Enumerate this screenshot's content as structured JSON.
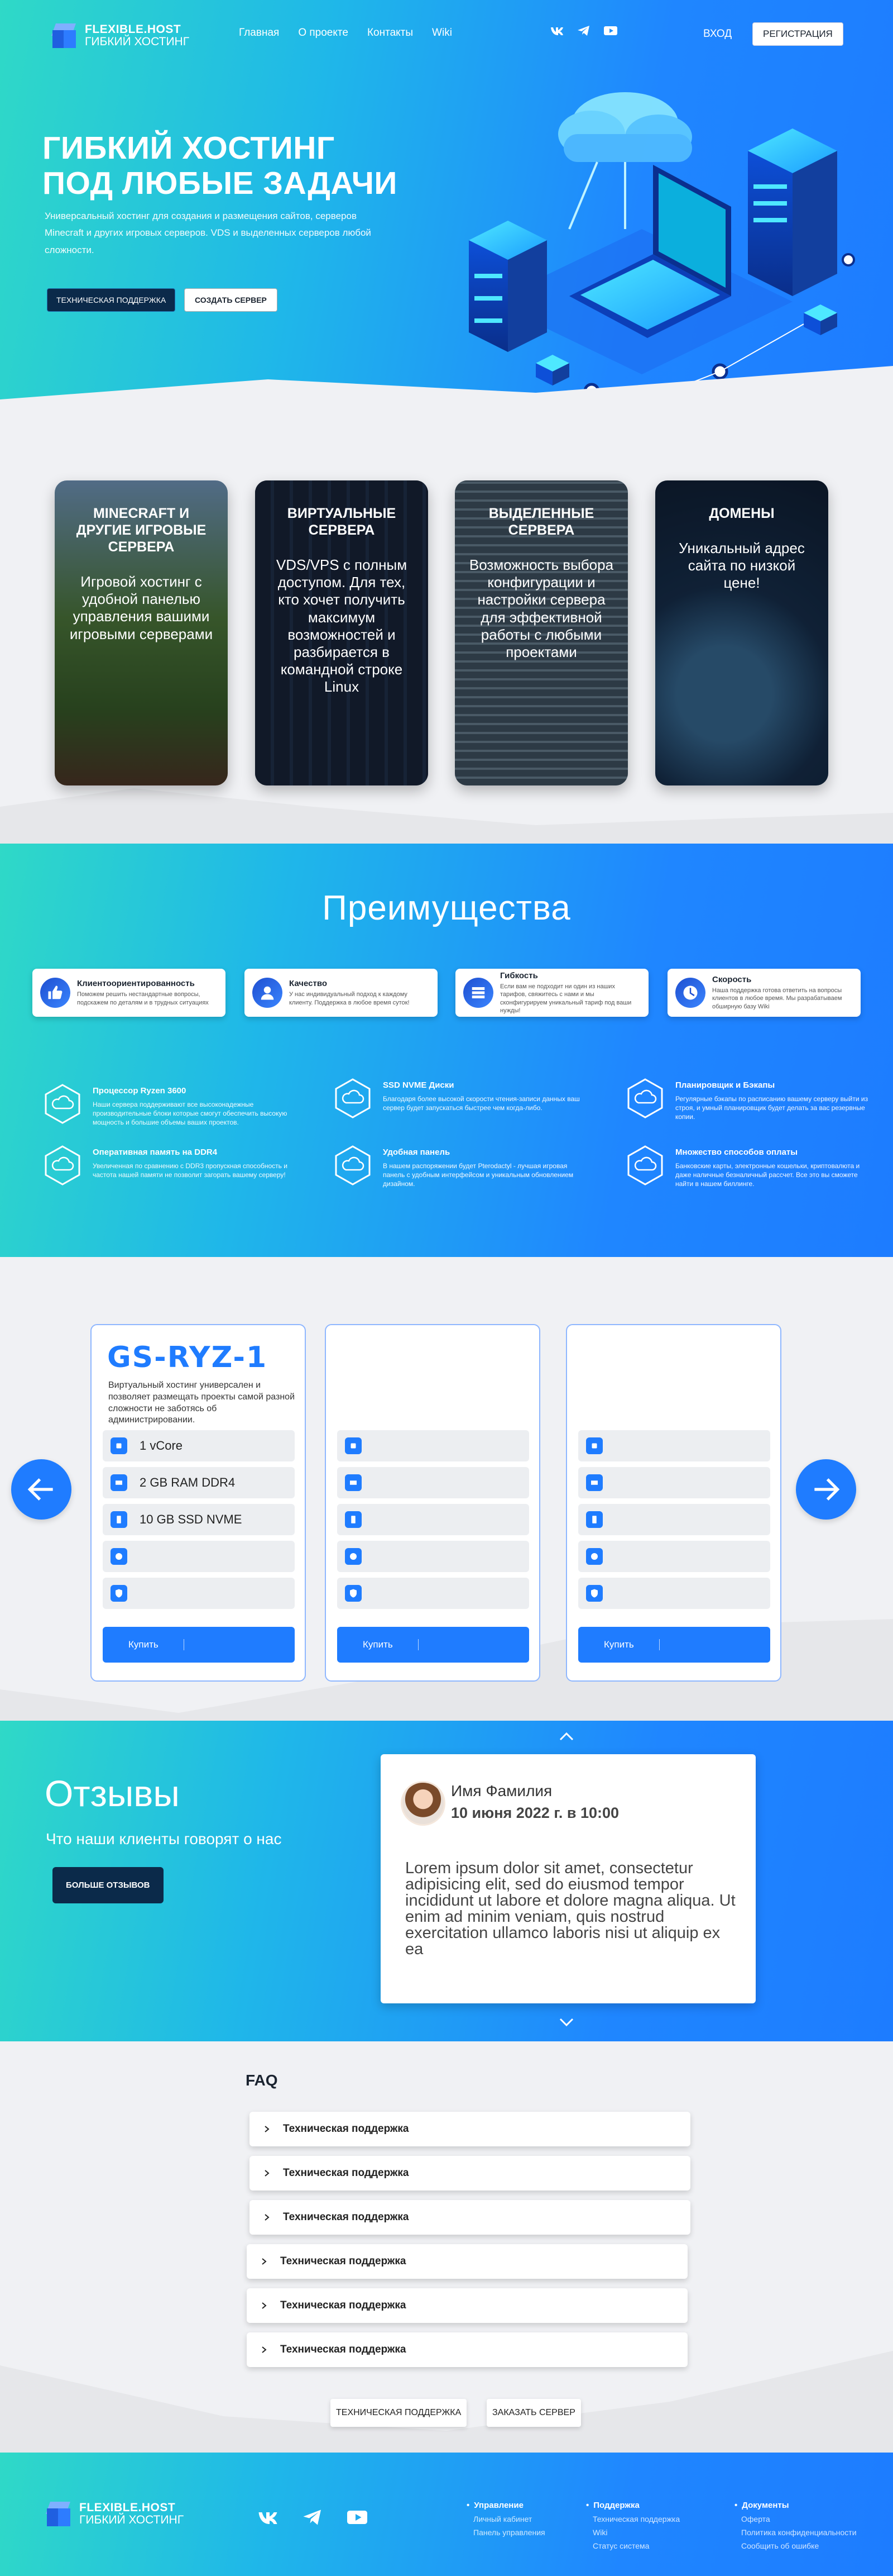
{
  "header": {
    "logo_line1": "FLEXIBLE.HOST",
    "logo_line2": "ГИБКИЙ ХОСТИНГ",
    "nav": [
      "Главная",
      "О проекте",
      "Контакты",
      "Wiki"
    ],
    "socials": [
      "vk-icon",
      "telegram-icon",
      "youtube-icon"
    ],
    "login_label": "ВХОД",
    "register_label": "РЕГИСТРАЦИЯ"
  },
  "hero": {
    "title_line1": "ГИБКИЙ ХОСТИНГ",
    "title_line2": "ПОД ЛЮБЫЕ ЗАДАЧИ",
    "lead": "Универсальный хостинг для создания и размещения сайтов, серверов Minecraft и других игровых серверов. VDS и выделенных серверов любой сложности.",
    "support_label": "ТЕХНИЧЕСКАЯ ПОДДЕРЖКА",
    "create_label": "СОЗДАТЬ СЕРВЕР"
  },
  "services": [
    {
      "title": "MINECRAFT И ДРУГИЕ ИГРОВЫЕ СЕРВЕРА",
      "text": "Игровой хостинг с удобной панелью управления вашими игровыми серверами",
      "color": "#4a7a2e"
    },
    {
      "title": "ВИРТУАЛЬНЫЕ СЕРВЕРА",
      "text": "VDS/VPS с полным доступом. Для тех, кто хочет получить максимум возможностей и разбирается в командной строке Linux",
      "color": "#243650"
    },
    {
      "title": "ВЫДЕЛЕННЫЕ СЕРВЕРА",
      "text": "Возможность выбора конфигурации и настройки сервера для эффективной работы с любыми проектами",
      "color": "#5a6e78"
    },
    {
      "title": "ДОМЕНЫ",
      "text": "Уникальный адрес сайта по низкой цене!",
      "color": "#1d3a5a"
    }
  ],
  "advantages": {
    "title": "Преимущества",
    "tiles": [
      {
        "title": "Клиентоориентированность",
        "text": "Поможем решить нестандартные вопросы, подскажем по деталям и в трудных ситуациях",
        "icon": "thumbs-up-icon"
      },
      {
        "title": "Качество",
        "text": "У нас индивидуальный подход к каждому клиенту. Поддержка в любое время суток!",
        "icon": "support-agent-icon"
      },
      {
        "title": "Гибкость",
        "text": "Если вам не подходит ни один из наших тарифов, свяжитесь с нами и мы сконфигурируем уникальный тариф под ваши нужды!",
        "icon": "servers-icon"
      },
      {
        "title": "Скорость",
        "text": "Наша поддержка готова ответить на вопросы клиентов в любое время. Мы разрабатываем обширную базу Wiki",
        "icon": "clock-icon"
      }
    ],
    "specs": [
      {
        "title": "Процессор Ryzen 3600",
        "text": "Наши сервера поддерживают все высоконадежные производительные блоки которые смогут обеспечить высокую мощность и большие объемы ваших проектов."
      },
      {
        "title": "SSD NVME Диски",
        "text": "Благодаря более высокой скорости чтения-записи данных ваш сервер будет запускаться быстрее чем когда-либо."
      },
      {
        "title": "Планировщик и Бэкапы",
        "text": "Регулярные бэкапы по расписанию вашему серверу выйти из строя, и умный планировщик будет делать за вас резервные копии."
      },
      {
        "title": "Оперативная память на DDR4",
        "text": "Увеличенная по сравнению с DDR3 пропускная способность и частота нашей памяти не позволит загорать вашему серверу!"
      },
      {
        "title": "Удобная панель",
        "text": "В нашем распоряжении будет Pterodactyl - лучшая игровая панель с удобным интерфейсом и уникальным обновлением дизайном."
      },
      {
        "title": "Множество способов оплаты",
        "text": "Банковские карты, электронные кошельки, криптовалюта и даже наличные безналичный рассчет. Все это вы сможете найти в нашем биллинге."
      }
    ]
  },
  "plans": {
    "plan1": {
      "name": "GS-RYZ-1",
      "desc": "Виртуальный хостинг универсален и позволяет размещать проекты самой разной сложности не заботясь об администрировании.",
      "features": [
        "1 vCore",
        "2 GB RAM DDR4",
        "10 GB SSD NVME",
        "",
        ""
      ]
    },
    "feature_icons": [
      "cpu-icon",
      "memory-icon",
      "ssd-icon",
      "globe-icon",
      "shield-icon"
    ],
    "buy_label": "Купить"
  },
  "reviews": {
    "title": "Отзывы",
    "subtitle": "Что наши клиенты говорят о нас",
    "more_label": "БОЛЬШЕ ОТЗЫВОВ",
    "name": "Имя Фамилия",
    "date": "10 июня 2022 г. в 10:00",
    "text": "Lorem ipsum dolor sit amet, consectetur adipisicing elit, sed do eiusmod tempor incididunt ut labore et dolore magna aliqua. Ut enim ad minim veniam, quis nostrud exercitation ullamco laboris nisi ut aliquip ex ea"
  },
  "faq": {
    "title": "FAQ",
    "items": [
      "Техническая поддержка",
      "Техническая поддержка",
      "Техническая поддержка",
      "Техническая поддержка",
      "Техническая поддержка",
      "Техническая поддержка"
    ],
    "support_label": "ТЕХНИЧЕСКАЯ ПОДДЕРЖКА",
    "order_label": "ЗАКАЗАТЬ СЕРВЕР"
  },
  "footer": {
    "col1": {
      "head": "Управление",
      "links": [
        "Личный кабинет",
        "Панель управления"
      ]
    },
    "col2": {
      "head": "Поддержка",
      "links": [
        "Техническая поддержка",
        "Wiki",
        "Статус система"
      ]
    },
    "col3": {
      "head": "Документы",
      "links": [
        "Оферта",
        "Политика конфиденциальности",
        "Сообщить об ошибке"
      ]
    }
  },
  "colors": {
    "accent": "#1f7cff",
    "dark": "#0b2a4a",
    "teal": "#2fd9c7"
  }
}
